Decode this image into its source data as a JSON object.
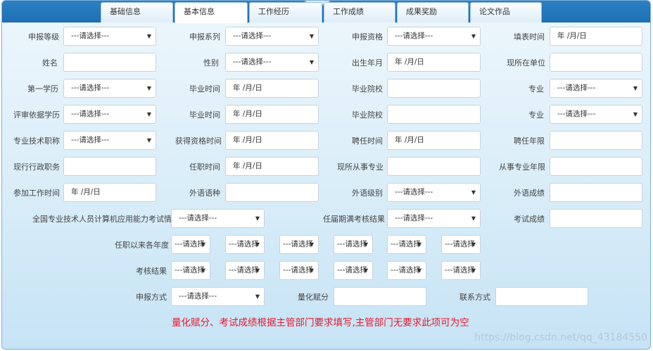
{
  "tabs": [
    "基础信息",
    "基本信息",
    "工作经历",
    "工作成绩",
    "成果奖励",
    "论文作品"
  ],
  "placeholders": {
    "select": "---请选择---",
    "select_short": "---请选择",
    "date": "年 /月/日"
  },
  "fields": {
    "declare_level": "申报等级",
    "declare_series": "申报系列",
    "declare_qualification": "申报资格",
    "fill_date": "填表时间",
    "name": "姓名",
    "gender": "性别",
    "birth_month": "出生年月",
    "current_unit": "现所在单位",
    "first_education": "第一学历",
    "graduation_time_1": "毕业时间",
    "graduation_school_1": "毕业院校",
    "major_1": "专业",
    "review_education": "评审依据学历",
    "graduation_time_2": "毕业时间",
    "graduation_school_2": "毕业院校",
    "major_2": "专业",
    "tech_title": "专业技术职称",
    "qualification_time": "获得资格时间",
    "appointment_time": "聘任时间",
    "appointment_years": "聘任年限",
    "current_admin_post": "现行行政职务",
    "tenure_time": "任职时间",
    "current_major": "现所从事专业",
    "major_years": "从事专业年限",
    "work_start_time": "参加工作时间",
    "foreign_language": "外语语种",
    "foreign_level": "外语级别",
    "foreign_score": "外语成绩",
    "computer_exam": "全国专业技术人员计算机应用能力考试情况",
    "term_assessment": "任届期满考核结果",
    "exam_score": "考试成绩",
    "annual_since_tenure": "任职以来各年度",
    "assessment_result": "考核结果",
    "declare_method": "申报方式",
    "quantified_score": "量化赋分",
    "contact": "联系方式"
  },
  "note": "量化赋分、考试成绩根据主管部门要求填写,主管部门无要求此项可为空",
  "watermark": "https://blog.csdn.net/qq_43184550",
  "colors": {
    "tab_bar": "#1e6fb3",
    "note": "#e8182b",
    "bg": "#d7ecf8"
  }
}
